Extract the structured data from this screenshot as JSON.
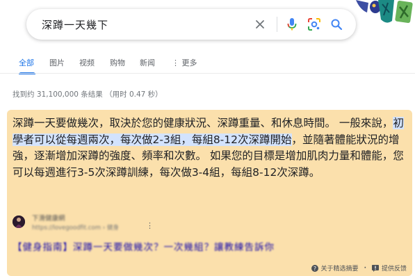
{
  "search": {
    "query": "深蹲一天幾下"
  },
  "tabs": [
    {
      "label": "全部"
    },
    {
      "label": "图片"
    },
    {
      "label": "视频"
    },
    {
      "label": "购物"
    },
    {
      "label": "新闻"
    },
    {
      "label": "更多"
    }
  ],
  "result_stats": "找到约 31,100,000 条结果 （用时 0.47 秒）",
  "snippet": {
    "text_before": "深蹲一天要做幾次，取決於您的健康狀況、深蹲重量、和休息時間。 一般來說，",
    "highlight": "初學者可以從每週兩次，每次做2-3組，每組8-12次深蹲開始",
    "text_after": "，並隨著體能狀況的增強，逐漸增加深蹲的強度、頻率和次數。 如果您的目標是增加肌肉力量和體能，您可以每週進行3-5次深蹲訓練，每次做3-4組，每組8-12次深蹲。",
    "source_name": "下滑健康網",
    "source_url": "https://lovegoodfit.com › 健身",
    "link_title": "【健身指南】深蹲一天要做幾次？一次幾組？讓教練告訴你",
    "footer_about": "关于精选摘要",
    "footer_feedback": "提供反馈"
  },
  "colors": {
    "accent": "#1a73e8",
    "snippet_bg": "#fbe0ac",
    "highlight": "#d3e3fd",
    "link": "#1a0dab"
  }
}
